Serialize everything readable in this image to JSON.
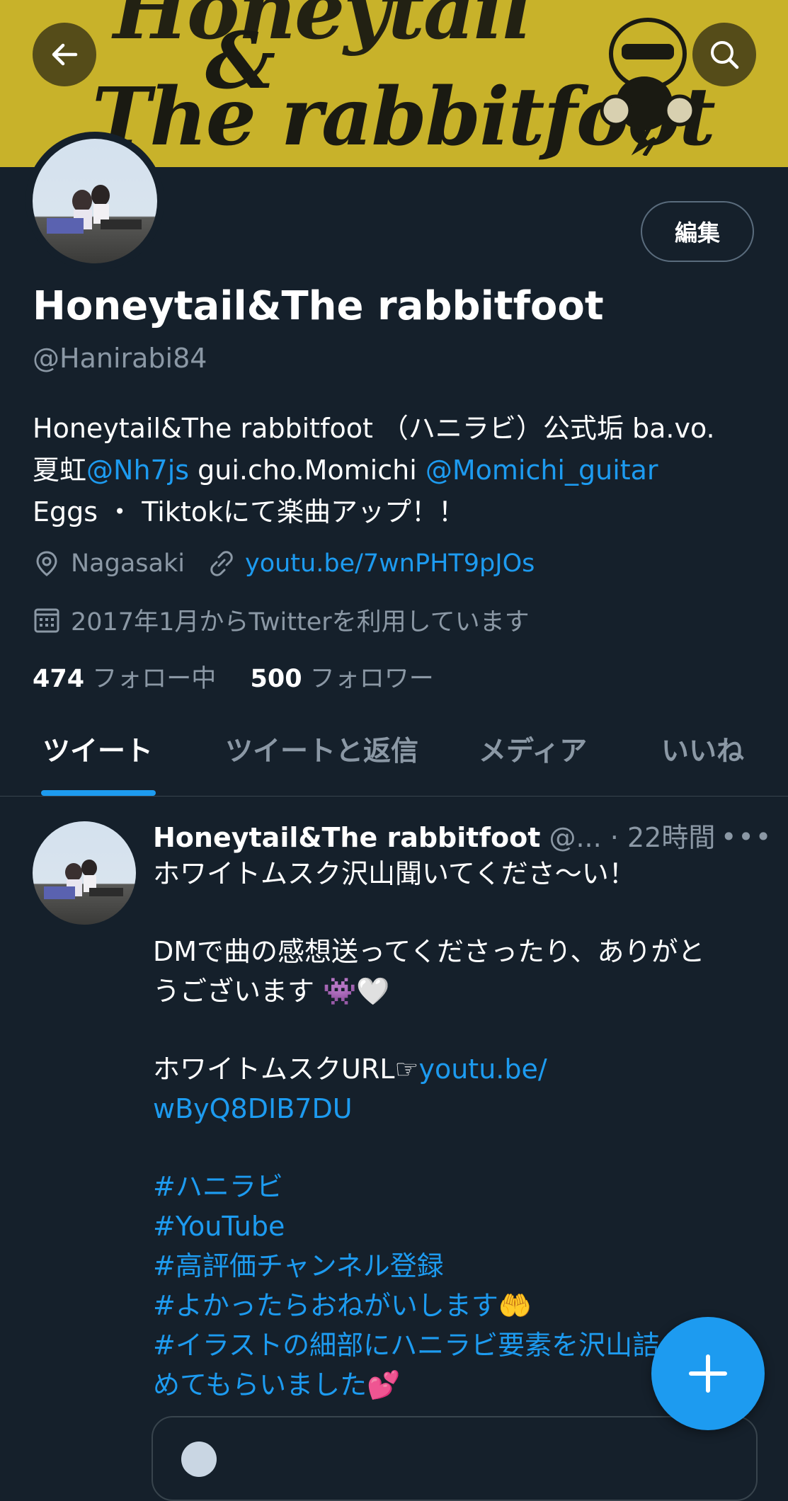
{
  "banner": {
    "line1": "Honeytail",
    "amp": "&",
    "line2": "The rabbitfoot"
  },
  "header": {
    "back_icon": "arrow-left-icon",
    "search_icon": "search-icon"
  },
  "profile": {
    "edit_label": "編集",
    "display_name": "Honeytail&The rabbitfoot",
    "handle": "@Hanirabi84",
    "bio_line1": "Honeytail&The rabbitfoot （ハニラビ）公式垢 ba.vo.",
    "bio_line2_a": "夏虹",
    "bio_mention1": "@Nh7js",
    "bio_line2_b": " gui.cho.Momichi ",
    "bio_mention2": "@Momichi_guitar",
    "bio_line3": "Eggs ・ Tiktokにて楽曲アップ！！",
    "location": "Nagasaki",
    "url": "youtu.be/7wnPHT9pJOs",
    "joined": "2017年1月からTwitterを利用しています",
    "following_count": "474",
    "following_label": "フォロー中",
    "followers_count": "500",
    "followers_label": "フォロワー"
  },
  "tabs": [
    {
      "label": "ツイート",
      "active": true
    },
    {
      "label": "ツイートと返信",
      "active": false
    },
    {
      "label": "メディア",
      "active": false
    },
    {
      "label": "いいね",
      "active": false
    }
  ],
  "tweet": {
    "author": "Honeytail&The rabbitfoot",
    "handle": "@...",
    "sep": " · ",
    "time": "22時間",
    "more": "•••",
    "line1": "ホワイトムスク沢山聞いてくださ〜い！",
    "line2": "DMで曲の感想送ってくださったり、ありがと",
    "line3": "うございます 👾🤍",
    "line4_text": "ホワイトムスクURL☞",
    "line4_link": "youtu.be/",
    "line5_link": "wByQ8DIB7DU",
    "hashtags": [
      "#ハニラビ",
      "#YouTube",
      "#高評価チャンネル登録",
      "#よかったらおねがいします🤲",
      "#イラストの細部にハニラビ要素を沢山詰",
      "めてもらいました💕"
    ]
  },
  "fab": {
    "icon": "plus-icon"
  },
  "colors": {
    "background": "#15202b",
    "accent": "#1d9bf0",
    "secondary_text": "#8b98a5",
    "banner": "#c8b22a"
  }
}
